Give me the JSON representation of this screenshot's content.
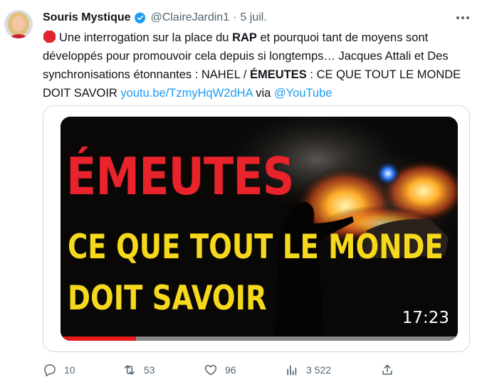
{
  "tweet": {
    "author_name": "Souris Mystique",
    "handle": "@ClaireJardin1",
    "separator": "·",
    "date": "5 juil.",
    "text_parts": {
      "p1": "Une interrogation sur la place du ",
      "p2": "RAP",
      "p3": " et pourquoi tant de moyens sont développés pour promouvoir cela depuis si longtemps… Jacques Attali et Des synchronisations étonnantes : NAHEL / ",
      "p4": "ÉMEUTES",
      "p5": " : CE QUE TOUT LE MONDE DOIT SAVOIR ",
      "link": "youtu.be/TzmyHqW2dHA",
      "p6": " via ",
      "mention": "@YouTube"
    }
  },
  "video_card": {
    "title_line1": "ÉMEUTES",
    "title_line2": "CE QUE TOUT LE MONDE",
    "title_line3": "DOIT SAVOIR",
    "duration": "17:23",
    "progress": 0.19
  },
  "actions": {
    "replies": "10",
    "retweets": "53",
    "likes": "96",
    "views": "3 522"
  },
  "colors": {
    "link": "#1d9bf0",
    "muted": "#536471",
    "verified": "#1d9bf0",
    "title_red": "#e8232b",
    "title_yellow": "#f6d91c"
  },
  "icons": [
    "verified-badge-icon",
    "more-icon",
    "stop-sign-icon",
    "reply-icon",
    "retweet-icon",
    "like-icon",
    "views-icon",
    "share-icon"
  ]
}
